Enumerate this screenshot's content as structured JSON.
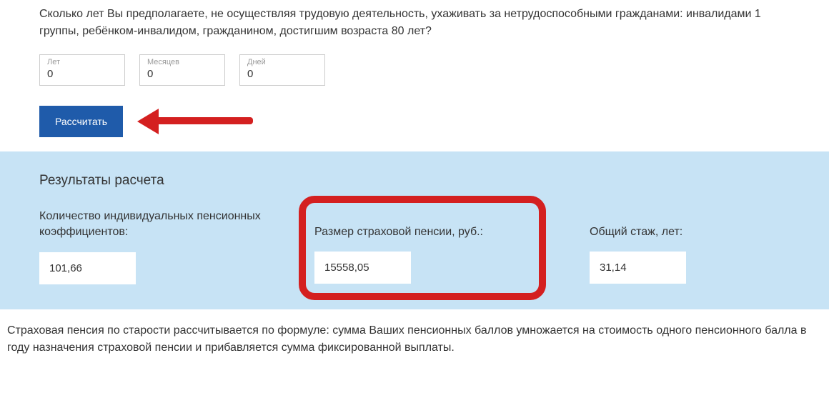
{
  "form": {
    "question": "Сколько лет Вы предполагаете, не осуществляя трудовую деятельность, ухаживать за нетрудоспособными гражданами: инвалидами 1 группы, ребёнком-инвалидом, гражданином, достигшим возраста 80 лет?",
    "inputs": {
      "years": {
        "label": "Лет",
        "value": "0"
      },
      "months": {
        "label": "Месяцев",
        "value": "0"
      },
      "days": {
        "label": "Дней",
        "value": "0"
      }
    },
    "calculate_label": "Рассчитать"
  },
  "results": {
    "title": "Результаты расчета",
    "coeff": {
      "label": "Количество индивидуальных пенсионных коэффициентов:",
      "value": "101,66"
    },
    "pension": {
      "label": "Размер страховой пенсии, руб.:",
      "value": "15558,05"
    },
    "stazh": {
      "label": "Общий стаж, лет:",
      "value": "31,14"
    }
  },
  "footer": "Страховая пенсия по старости рассчитывается по формуле: сумма Ваших пенсионных баллов умножается на стоимость одного пенсионного балла в году назначения страховой пенсии и прибавляется сумма фиксированной выплаты."
}
